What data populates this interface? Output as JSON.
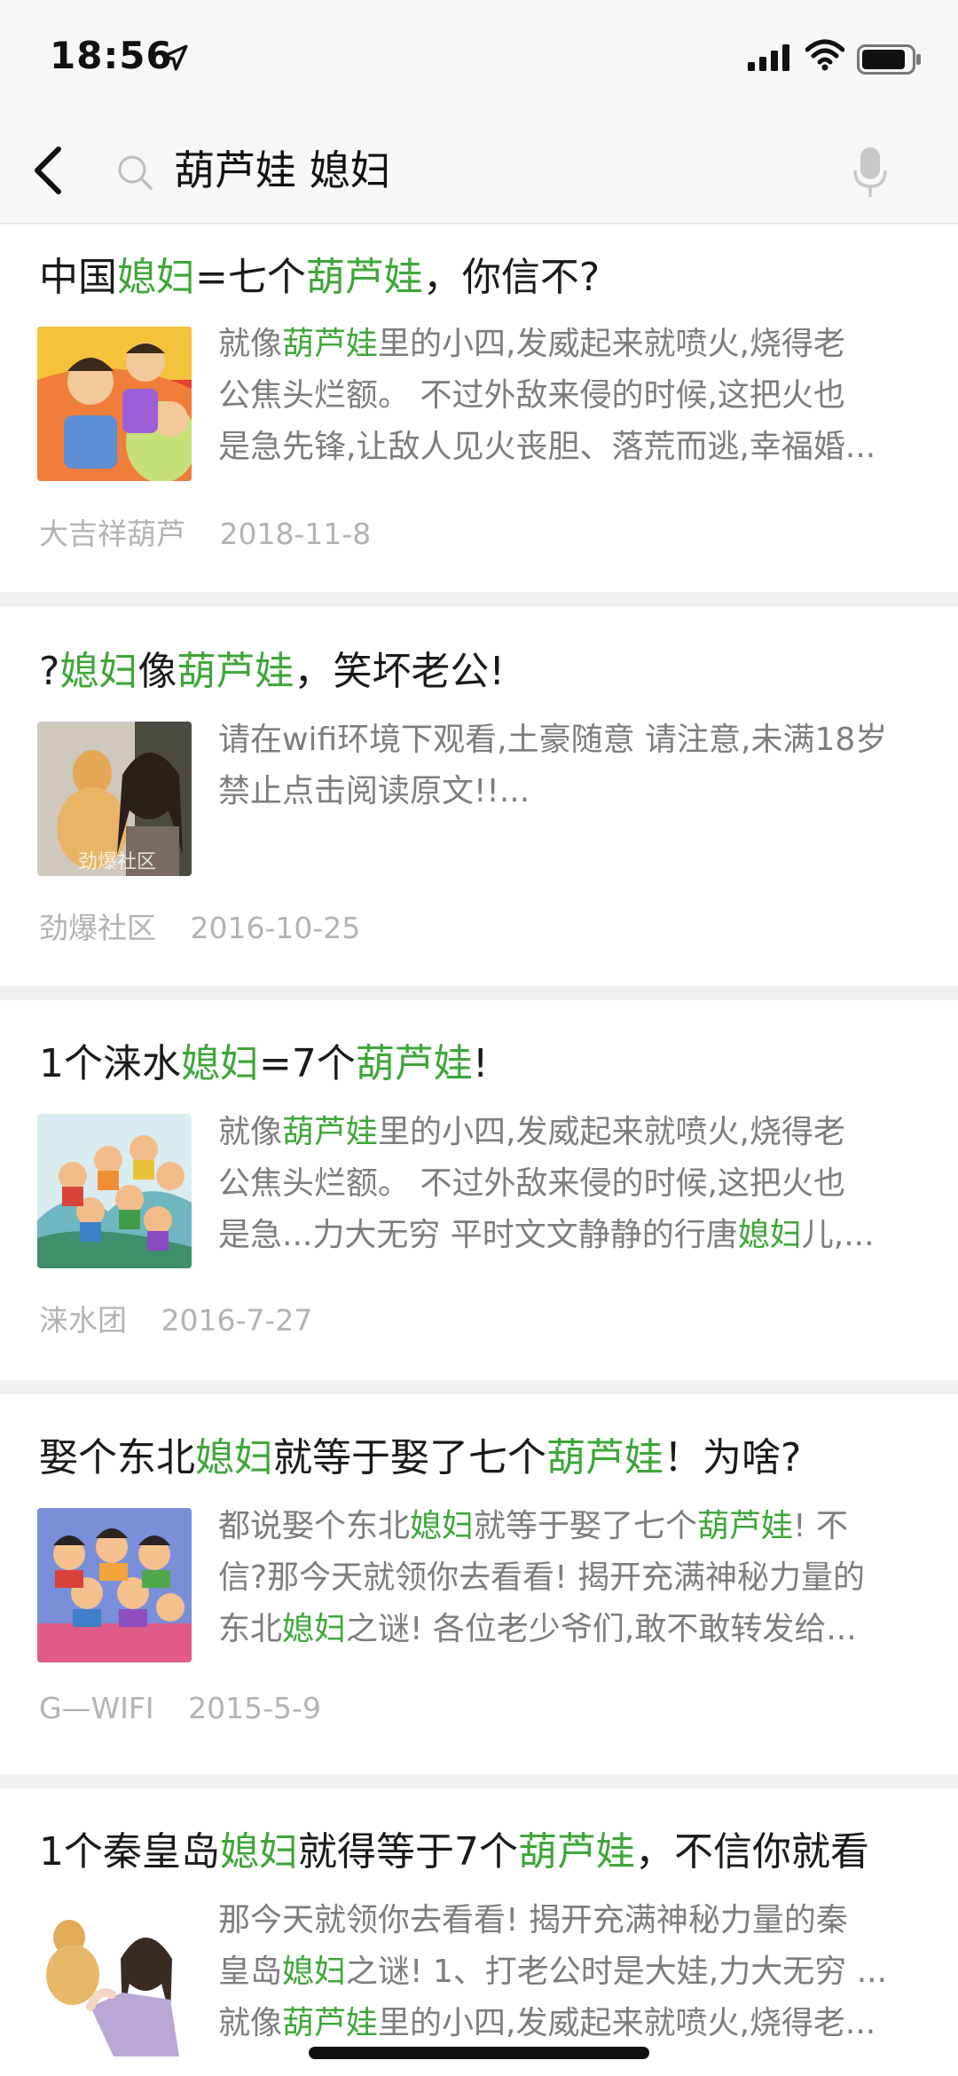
{
  "status": {
    "time": "18:56",
    "icons": [
      "location-arrow-icon",
      "signal-icon",
      "wifi-icon",
      "battery-icon"
    ]
  },
  "search": {
    "query": "葫芦娃 媳妇",
    "icons": [
      "back-arrow-icon",
      "search-icon",
      "microphone-icon"
    ]
  },
  "colors": {
    "highlight": "#3fa63a",
    "snippet": "#7d7d7d",
    "meta": "#b3b3b3"
  },
  "results": [
    {
      "title": [
        {
          "t": "中国"
        },
        {
          "t": "媳妇",
          "hl": true
        },
        {
          "t": "=七个"
        },
        {
          "t": "葫芦娃",
          "hl": true
        },
        {
          "t": "，你信不?"
        }
      ],
      "snippet": [
        [
          {
            "t": "就像"
          },
          {
            "t": "葫芦娃",
            "hl": true
          },
          {
            "t": "里的小四,发威起来就喷火,烧得老"
          }
        ],
        [
          {
            "t": "公焦头烂额。 不过外敌来侵的时候,这把火也"
          }
        ],
        [
          {
            "t": "是急先锋,让敌人见火丧胆、落荒而逃,幸福婚..."
          }
        ]
      ],
      "source": "大吉祥葫芦",
      "date": "2018-11-8"
    },
    {
      "title": [
        {
          "t": "?"
        },
        {
          "t": "媳妇",
          "hl": true
        },
        {
          "t": "像"
        },
        {
          "t": "葫芦娃",
          "hl": true
        },
        {
          "t": "，笑坏老公!"
        }
      ],
      "snippet": [
        [
          {
            "t": "请在wifi环境下观看,土豪随意 请注意,未满18岁"
          }
        ],
        [
          {
            "t": "禁止点击阅读原文!!..."
          }
        ]
      ],
      "source": "劲爆社区",
      "date": "2016-10-25",
      "thumb_watermark": "劲爆社区"
    },
    {
      "title": [
        {
          "t": "1个涞水"
        },
        {
          "t": "媳妇",
          "hl": true
        },
        {
          "t": "=7个"
        },
        {
          "t": "葫芦娃",
          "hl": true
        },
        {
          "t": "!"
        }
      ],
      "snippet": [
        [
          {
            "t": "就像"
          },
          {
            "t": "葫芦娃",
            "hl": true
          },
          {
            "t": "里的小四,发威起来就喷火,烧得老"
          }
        ],
        [
          {
            "t": "公焦头烂额。 不过外敌来侵的时候,这把火也"
          }
        ],
        [
          {
            "t": "是急...力大无穷 平时文文静静的行唐"
          },
          {
            "t": "媳妇",
            "hl": true
          },
          {
            "t": "儿,..."
          }
        ]
      ],
      "source": "涞水团",
      "date": "2016-7-27"
    },
    {
      "title": [
        {
          "t": "娶个东北"
        },
        {
          "t": "媳妇",
          "hl": true
        },
        {
          "t": "就等于娶了七个"
        },
        {
          "t": "葫芦娃",
          "hl": true
        },
        {
          "t": "！为啥?"
        }
      ],
      "snippet": [
        [
          {
            "t": "都说娶个东北"
          },
          {
            "t": "媳妇",
            "hl": true
          },
          {
            "t": "就等于娶了七个"
          },
          {
            "t": "葫芦娃",
            "hl": true
          },
          {
            "t": "! 不"
          }
        ],
        [
          {
            "t": "信?那今天就领你去看看! 揭开充满神秘力量的"
          }
        ],
        [
          {
            "t": "东北"
          },
          {
            "t": "媳妇",
            "hl": true
          },
          {
            "t": "之谜! 各位老少爷们,敢不敢转发给..."
          }
        ]
      ],
      "source": "G—WIFI",
      "date": "2015-5-9"
    },
    {
      "title": [
        {
          "t": "1个秦皇岛"
        },
        {
          "t": "媳妇",
          "hl": true
        },
        {
          "t": "就得等于7个"
        },
        {
          "t": "葫芦娃",
          "hl": true
        },
        {
          "t": "，不信你就看"
        }
      ],
      "snippet": [
        [
          {
            "t": "那今天就领你去看看! 揭开充满神秘力量的秦"
          }
        ],
        [
          {
            "t": "皇岛"
          },
          {
            "t": "媳妇",
            "hl": true
          },
          {
            "t": "之谜! 1、打老公时是大娃,力大无穷 ..."
          }
        ],
        [
          {
            "t": "就像"
          },
          {
            "t": "葫芦娃",
            "hl": true
          },
          {
            "t": "里的小四,发威起来就喷火,烧得老..."
          }
        ]
      ],
      "source": "",
      "date": ""
    }
  ]
}
